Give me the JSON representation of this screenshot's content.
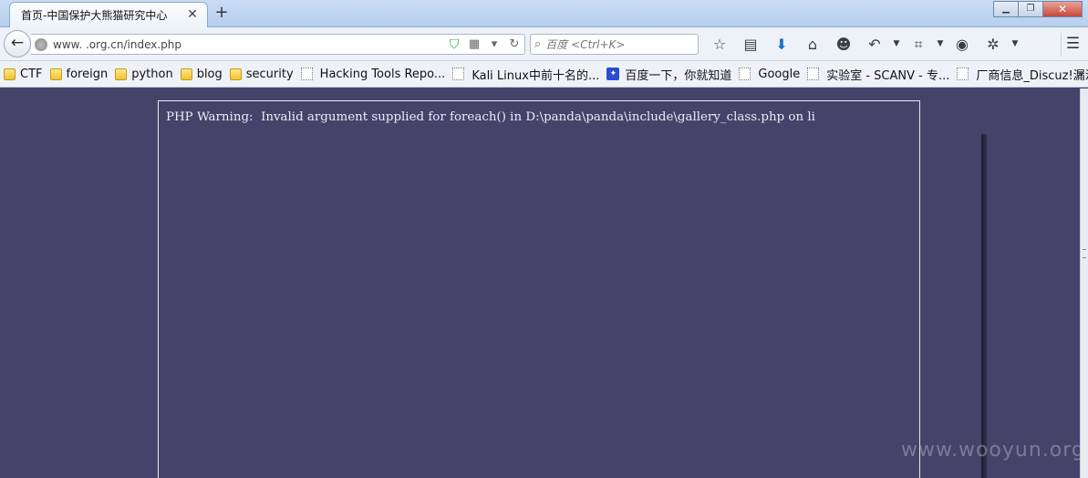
{
  "tab": {
    "title": "首页-中国保护大熊猫研究中心",
    "close": "✕",
    "new": "+"
  },
  "window": {
    "minimize": "▁",
    "restore": "❐",
    "close": "✕"
  },
  "nav": {
    "back": "←",
    "url": "www.            .org.cn/index.php",
    "search_placeholder": "百度 <Ctrl+K>",
    "menu": "☰"
  },
  "toolbar_icons": [
    "star-icon",
    "reader-icon",
    "download-icon",
    "home-icon",
    "emoji-icon",
    "undo-icon",
    "crop-icon",
    "chat-icon",
    "addon-icon"
  ],
  "bookmarks": [
    {
      "type": "folder",
      "label": "CTF"
    },
    {
      "type": "folder",
      "label": "foreign"
    },
    {
      "type": "folder",
      "label": "python"
    },
    {
      "type": "folder",
      "label": "blog"
    },
    {
      "type": "folder",
      "label": "security"
    },
    {
      "type": "page",
      "label": "Hacking Tools Repo..."
    },
    {
      "type": "page",
      "label": "Kali Linux中前十名的..."
    },
    {
      "type": "baidu",
      "label": "百度一下，你就知道"
    },
    {
      "type": "page",
      "label": "Google"
    },
    {
      "type": "page",
      "label": "实验室 - SCANV - 专..."
    },
    {
      "type": "page",
      "label": "厂商信息_Discuz!漏洞..."
    }
  ],
  "bookmarks_more": "»",
  "content": {
    "warning": "PHP Warning:  Invalid argument supplied for foreach() in D:\\panda\\panda\\include\\gallery_class.php on li",
    "watermark": "www.wooyun.org"
  }
}
